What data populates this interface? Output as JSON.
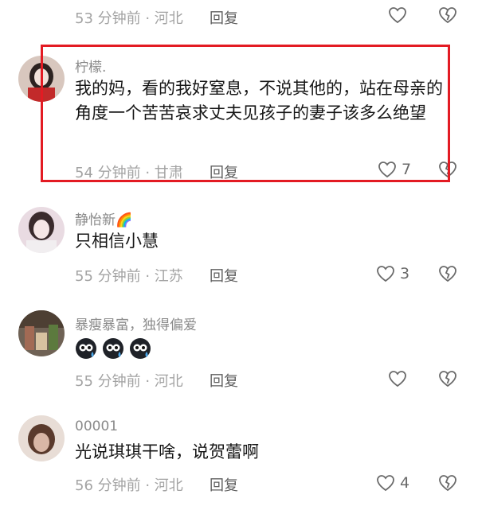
{
  "comments": [
    {
      "username": "",
      "text": "",
      "meta": "53 分钟前 · 河北",
      "reply": "回复",
      "likes": ""
    },
    {
      "username": "柠檬.",
      "text": "我的妈，看的我好窒息，不说其他的，站在母亲的角度一个苦苦哀求丈夫见孩子的妻子该多么绝望",
      "meta": "54 分钟前 · 甘肃",
      "reply": "回复",
      "likes": "7"
    },
    {
      "username": "静怡新🌈",
      "text": "只相信小慧",
      "meta": "55 分钟前 · 江苏",
      "reply": "回复",
      "likes": "3"
    },
    {
      "username": "暴瘦暴富，独得偏爱",
      "text": "",
      "meta": "55 分钟前 · 河北",
      "reply": "回复",
      "likes": ""
    },
    {
      "username": "00001",
      "text": "光说琪琪干啥，说贺蕾啊",
      "meta": "56 分钟前 · 河北",
      "reply": "回复",
      "likes": "4"
    }
  ],
  "icons": {
    "like": "heart-outline-icon",
    "dislike": "broken-heart-icon",
    "emoji": "sweat-blob-emoji"
  },
  "colors": {
    "highlight": "#e31b23",
    "text": "#161616",
    "meta": "#a3a3a3"
  }
}
